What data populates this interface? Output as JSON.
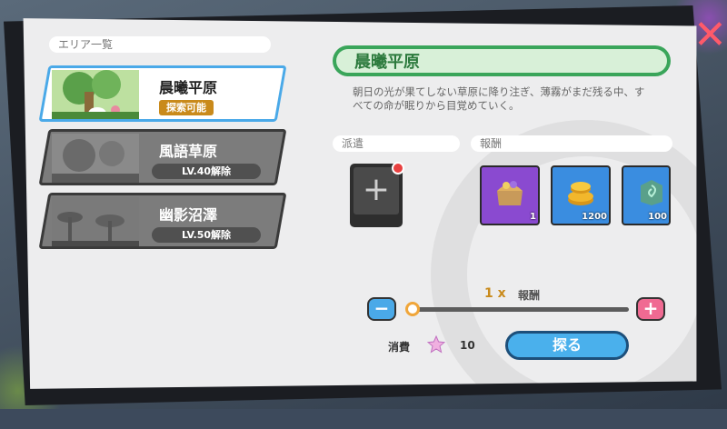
{
  "area_list": {
    "header": "エリア一覧",
    "items": [
      {
        "name": "晨曦平原",
        "status": "探索可能",
        "selected": true
      },
      {
        "name": "風語草原",
        "status": "LV.40解除",
        "selected": false
      },
      {
        "name": "幽影沼澤",
        "status": "LV.50解除",
        "selected": false
      }
    ]
  },
  "detail": {
    "title": "晨曦平原",
    "description": "朝日の光が果てしない草原に降り注ぎ、薄霧がまだ残る中、すべての命が眠りから目覚めていく。",
    "dispatch_label": "派遣",
    "reward_label": "報酬",
    "rewards": [
      {
        "icon": "treasure-chest-icon",
        "qty": "1"
      },
      {
        "icon": "gold-coins-icon",
        "qty": "1200"
      },
      {
        "icon": "green-rune-stone-icon",
        "qty": "100"
      }
    ]
  },
  "multiplier": {
    "value": "1 x",
    "label": "報酬",
    "level": 0.0
  },
  "cost": {
    "label": "消費",
    "value": "10",
    "icon": "star-icon"
  },
  "explore_button": "探る",
  "colors": {
    "accent_green": "#3aa55a",
    "accent_blue": "#4aa9e8",
    "pink": "#f06a92",
    "gold": "#c98a1b"
  }
}
